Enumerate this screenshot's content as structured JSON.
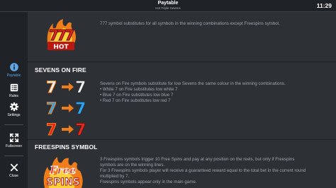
{
  "header": {
    "title": "Paytable",
    "subtitle": "Hot Triple Sevens",
    "clock": "11:29"
  },
  "sidebar": {
    "items": [
      {
        "label": "Paytable",
        "icon": "info-icon",
        "active": true
      },
      {
        "label": "Rules",
        "icon": "list-icon",
        "active": false
      },
      {
        "label": "Settings",
        "icon": "gear-icon",
        "active": false
      },
      {
        "label": "Fullscreen",
        "icon": "fullscreen-icon",
        "active": false
      },
      {
        "label": "Close",
        "icon": "close-icon",
        "active": false
      }
    ]
  },
  "sections": {
    "hot": {
      "symbol_text": "HOT",
      "lines": [
        "777 symbol substitutes for all symbols in the winning combinations except Freespins symbol."
      ]
    },
    "sevens_on_fire": {
      "title": "SEVENS ON FIRE",
      "lines": [
        "Sevens on Fire symbols substitute for low Sevens the same colour in the winning combinations.",
        "• White 7 on Fire substitutes low white 7",
        "• Blue 7 on Fire substitutes low blue 7",
        "• Red 7 on Fire substitutes low red 7"
      ]
    },
    "freespins": {
      "title": "FREESPINS SYMBOL",
      "symbol_text_1": "Free",
      "symbol_text_2": "SPINS",
      "lines": [
        "3 Freespins symbols trigger 10 Free Spins and pay at any position on the reels, but only if Freespins",
        "symbols are on the winning lines.",
        "For 3 Freespins symbols player will receive a guaranteed reward equal to the total bet in the current round",
        "multiplied by 7.",
        "Freespins symbols appear only in the main game."
      ]
    }
  },
  "colors": {
    "active_nav": "#5fa8e8",
    "seven_white": "#f2f2f2",
    "seven_blue": "#2fa7f0",
    "seven_red": "#e8271c",
    "fire_orange": "#f07c1a"
  }
}
